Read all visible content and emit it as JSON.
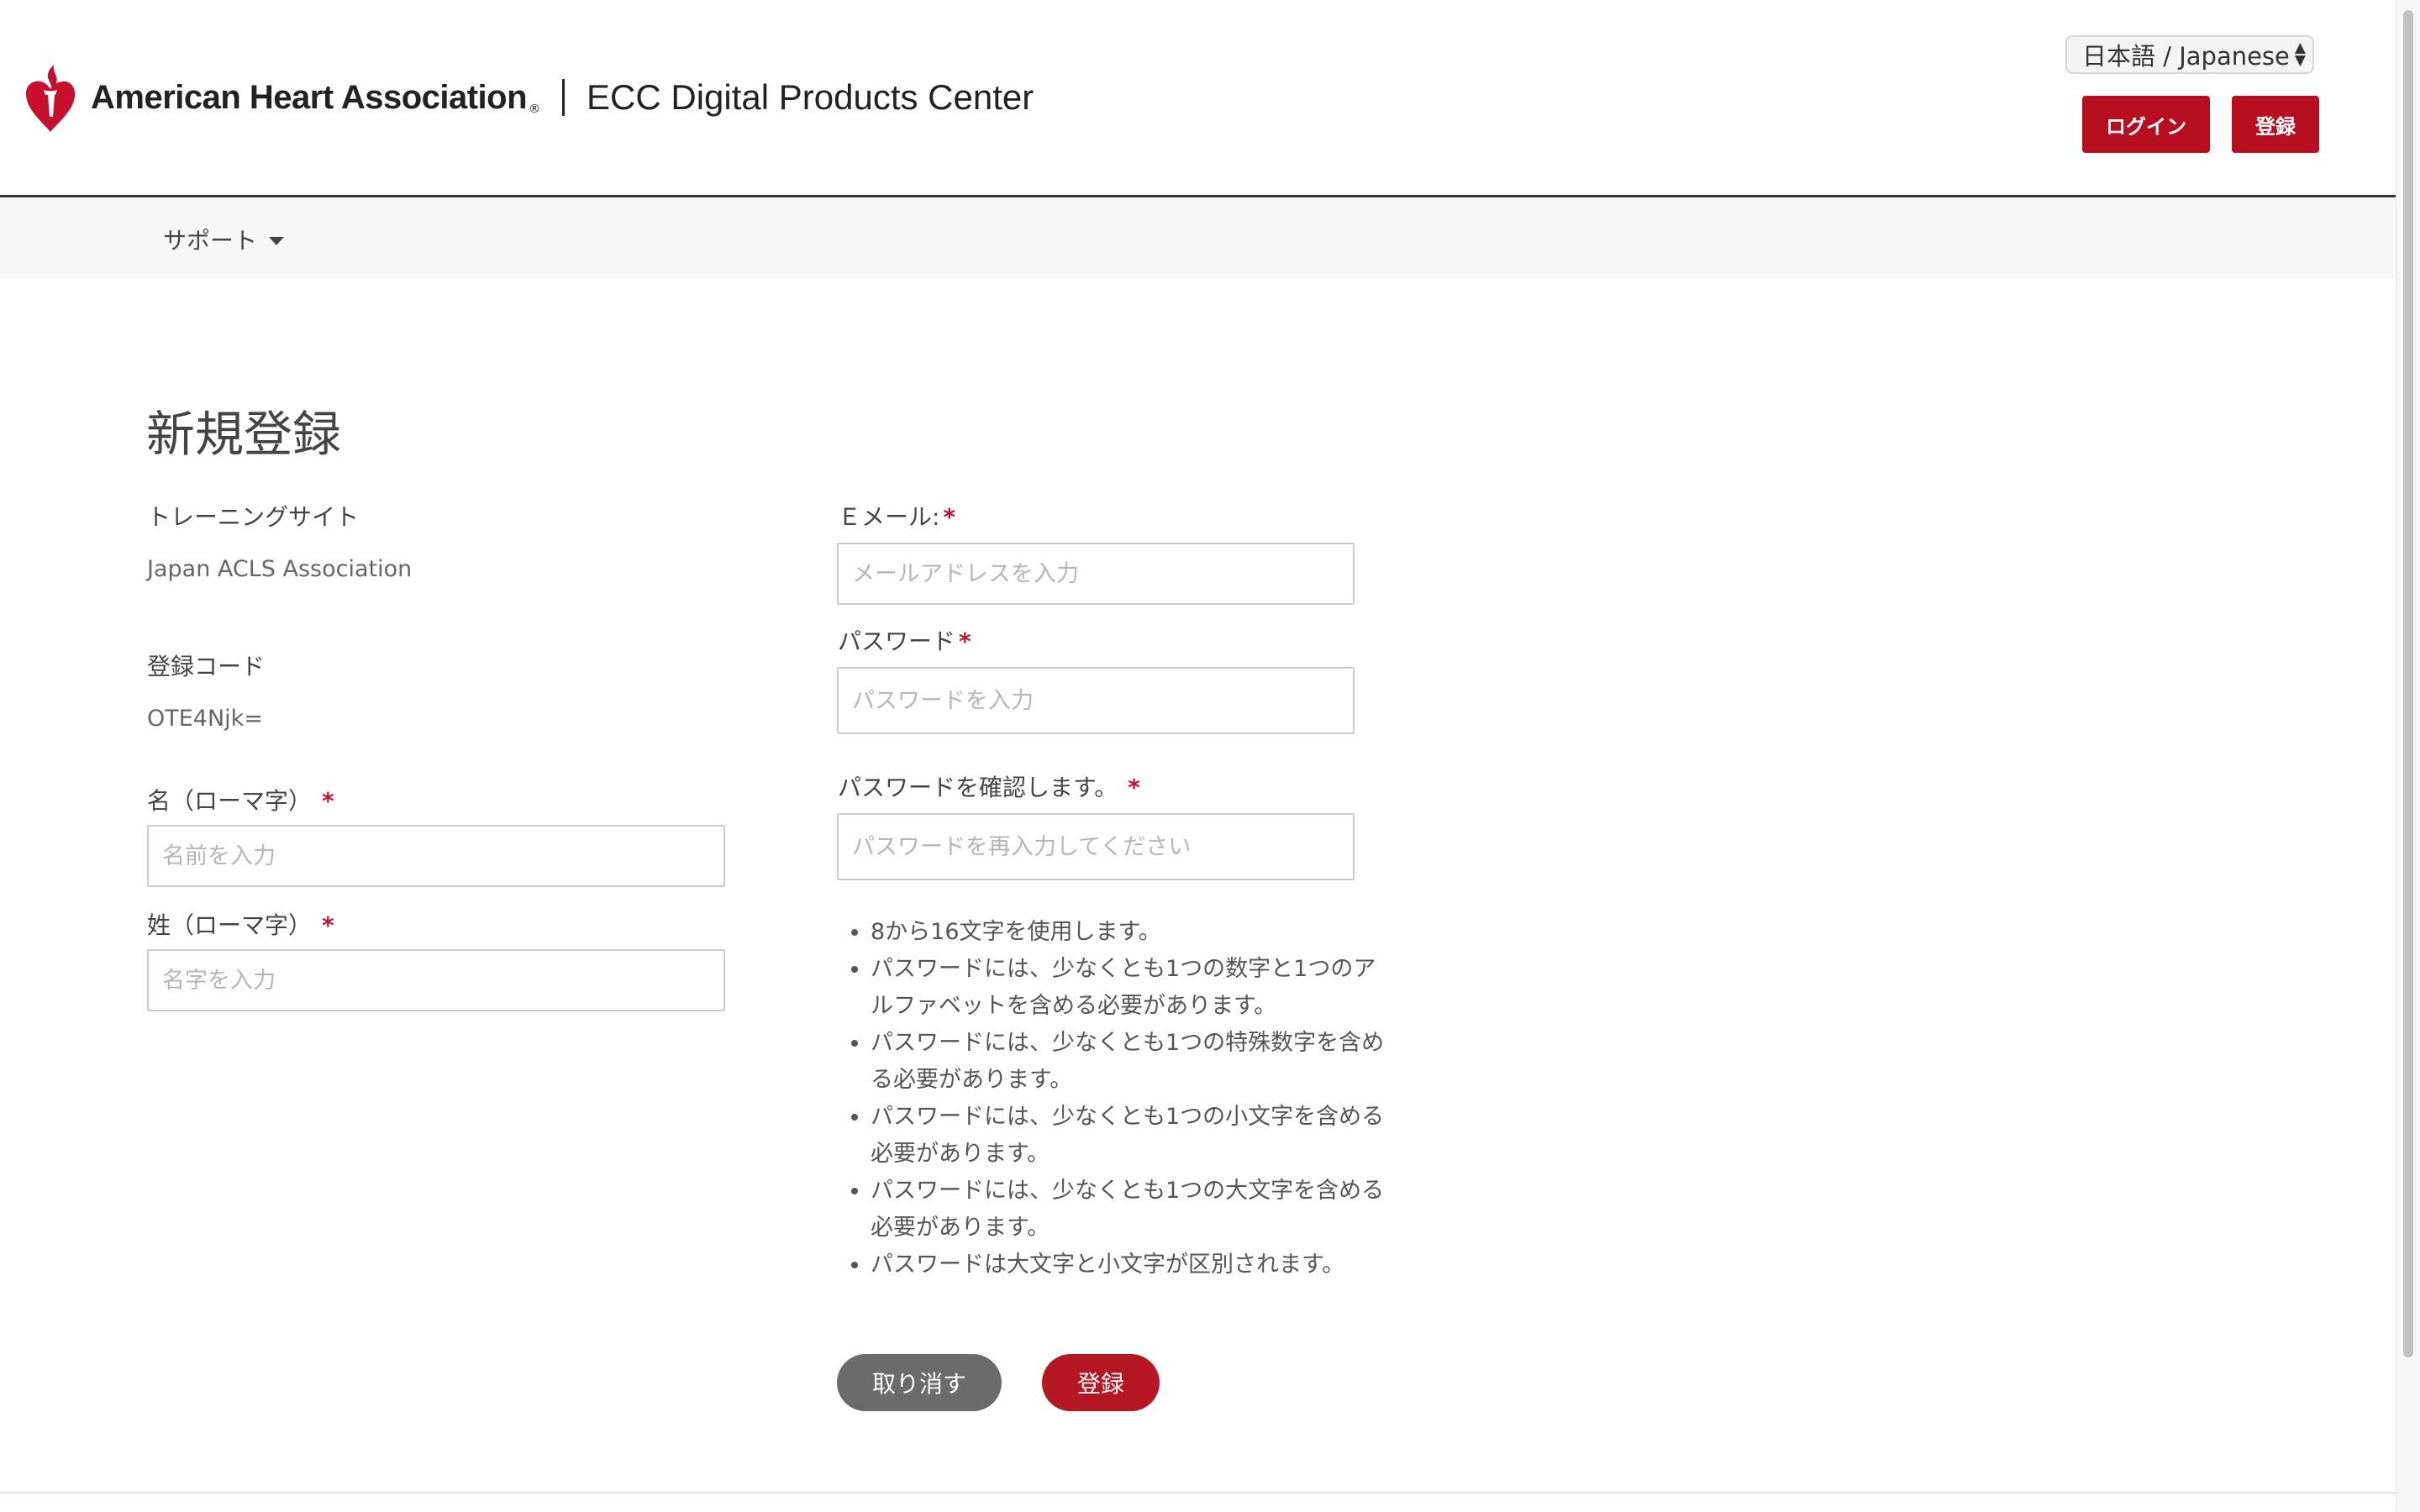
{
  "header": {
    "brand_name": "American Heart Association",
    "brand_mark": "®",
    "product_name": "ECC Digital Products Center",
    "language": "日本語 / Japanese",
    "login_label": "ログイン",
    "register_label": "登録"
  },
  "nav": {
    "support_label": "サポート"
  },
  "page": {
    "title": "新規登録"
  },
  "form": {
    "training_site_label": "トレーニングサイト",
    "training_site_value": "Japan ACLS Association",
    "registration_code_label": "登録コード",
    "registration_code_value": "OTE4Njk=",
    "first_name_label": "名（ローマ字）",
    "first_name_placeholder": "名前を入力",
    "last_name_label": "姓（ローマ字）",
    "last_name_placeholder": "名字を入力",
    "email_label": "Ｅメール:",
    "email_placeholder": "メールアドレスを入力",
    "password_label": "パスワード",
    "password_placeholder": "パスワードを入力",
    "confirm_password_label": "パスワードを確認します。",
    "confirm_password_placeholder": "パスワードを再入力してください",
    "required_mark": "*",
    "password_rules": [
      "8から16文字を使用します。",
      "パスワードには、少なくとも1つの数字と1つのアルファベットを含める必要があります。",
      "パスワードには、少なくとも1つの特殊数字を含める必要があります。",
      "パスワードには、少なくとも1つの小文字を含める必要があります。",
      "パスワードには、少なくとも1つの大文字を含める必要があります。",
      "パスワードは大文字と小文字が区別されます。"
    ],
    "cancel_label": "取り消す",
    "submit_label": "登録"
  },
  "colors": {
    "brand_red": "#b70f1f",
    "cancel_gray": "#6b6b6b",
    "required_red": "#c8102e"
  },
  "icons": {
    "logo": "heart-torch-icon",
    "support_menu": "caret-down-icon",
    "language_select": "up-down-arrows-icon"
  }
}
